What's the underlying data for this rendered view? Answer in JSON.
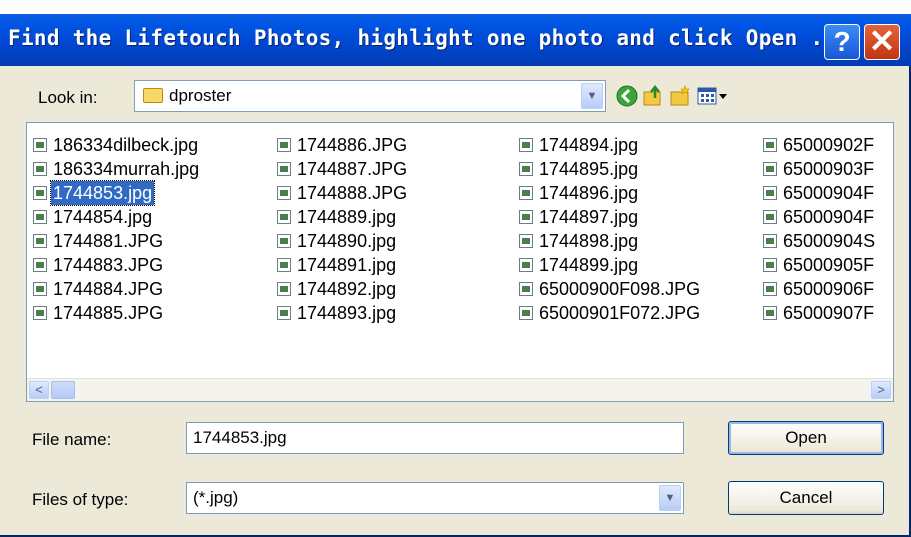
{
  "dialog": {
    "title": "Find the Lifetouch Photos, highlight one photo and click Open ...",
    "help_glyph": "?",
    "close_glyph": "✕"
  },
  "look_in": {
    "label": "Look in:",
    "value": "dproster"
  },
  "toolbar": {
    "icons": [
      "back-icon",
      "up-folder-icon",
      "new-folder-icon",
      "view-menu-icon"
    ]
  },
  "files": {
    "columns": [
      [
        "186334dilbeck.jpg",
        "186334murrah.jpg",
        "1744853.jpg",
        "1744854.jpg",
        "1744881.JPG",
        "1744883.JPG",
        "1744884.JPG",
        "1744885.JPG"
      ],
      [
        "1744886.JPG",
        "1744887.JPG",
        "1744888.JPG",
        "1744889.jpg",
        "1744890.jpg",
        "1744891.jpg",
        "1744892.jpg",
        "1744893.jpg"
      ],
      [
        "1744894.jpg",
        "1744895.jpg",
        "1744896.jpg",
        "1744897.jpg",
        "1744898.jpg",
        "1744899.jpg",
        "65000900F098.JPG",
        "65000901F072.JPG"
      ],
      [
        "65000902F",
        "65000903F",
        "65000904F",
        "65000904F",
        "65000904S",
        "65000905F",
        "65000906F",
        "65000907F"
      ]
    ],
    "selected": "1744853.jpg"
  },
  "scrollbar": {
    "left_arrow": "<",
    "right_arrow": ">"
  },
  "file_name": {
    "label": "File name:",
    "value": "1744853.jpg"
  },
  "file_type": {
    "label": "Files of type:",
    "value": "(*.jpg)"
  },
  "buttons": {
    "open": "Open",
    "cancel": "Cancel"
  },
  "colors": {
    "titlebar": "#0055e5",
    "selection": "#316ac5",
    "dialog_bg": "#ece9d8"
  }
}
